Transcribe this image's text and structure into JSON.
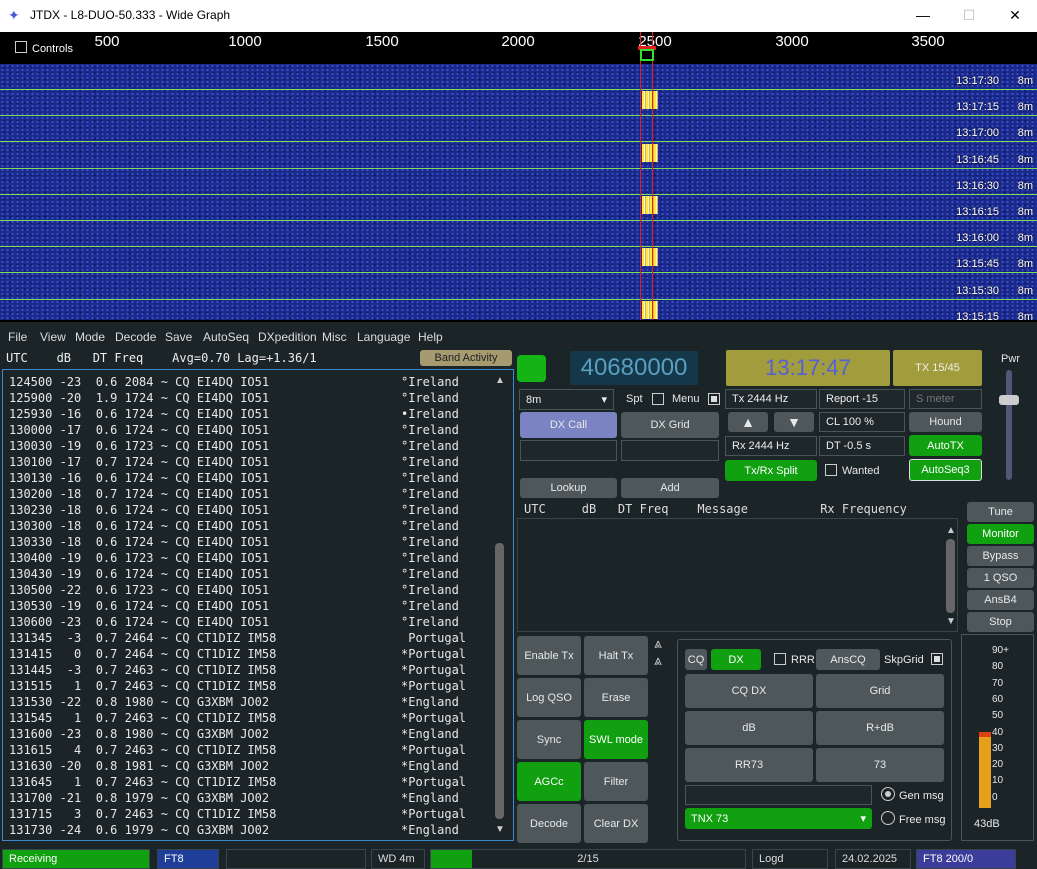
{
  "window": {
    "title": "JTDX - L8-DUO-50.333 - Wide Graph",
    "minimize": "—",
    "maximize": "☐",
    "close": "✕"
  },
  "widegraph": {
    "controls_label": "Controls",
    "scale": [
      "500",
      "1000",
      "1500",
      "2000",
      "2500",
      "3000",
      "3500"
    ],
    "timestamps": [
      [
        "13:17:30",
        "8m"
      ],
      [
        "13:17:15",
        "8m"
      ],
      [
        "13:17:00",
        "8m"
      ],
      [
        "13:16:45",
        "8m"
      ],
      [
        "13:16:30",
        "8m"
      ],
      [
        "13:16:15",
        "8m"
      ],
      [
        "13:16:00",
        "8m"
      ],
      [
        "13:15:45",
        "8m"
      ],
      [
        "13:15:30",
        "8m"
      ],
      [
        "13:15:15",
        "8m"
      ]
    ]
  },
  "menu": [
    "File",
    "View",
    "Mode",
    "Decode",
    "Save",
    "AutoSeq",
    "DXpedition",
    "Misc",
    "Language",
    "Help"
  ],
  "left": {
    "header": "UTC    dB   DT Freq    Avg=0.70 Lag=+1.36/1",
    "band_activity": "Band Activity",
    "rows": [
      [
        "124500 -23  0.6 2084 ~ CQ EI4DQ IO51",
        "°Ireland"
      ],
      [
        "125900 -20  1.9 1724 ~ CQ EI4DQ IO51",
        "°Ireland"
      ],
      [
        "125930 -16  0.6 1724 ~ CQ EI4DQ IO51",
        "•Ireland"
      ],
      [
        "130000 -17  0.6 1724 ~ CQ EI4DQ IO51",
        "°Ireland"
      ],
      [
        "130030 -19  0.6 1723 ~ CQ EI4DQ IO51",
        "°Ireland"
      ],
      [
        "130100 -17  0.7 1724 ~ CQ EI4DQ IO51",
        "°Ireland"
      ],
      [
        "130130 -16  0.6 1724 ~ CQ EI4DQ IO51",
        "°Ireland"
      ],
      [
        "130200 -18  0.7 1724 ~ CQ EI4DQ IO51",
        "°Ireland"
      ],
      [
        "130230 -18  0.6 1724 ~ CQ EI4DQ IO51",
        "°Ireland"
      ],
      [
        "130300 -18  0.6 1724 ~ CQ EI4DQ IO51",
        "°Ireland"
      ],
      [
        "130330 -18  0.6 1724 ~ CQ EI4DQ IO51",
        "°Ireland"
      ],
      [
        "130400 -19  0.6 1723 ~ CQ EI4DQ IO51",
        "°Ireland"
      ],
      [
        "130430 -19  0.6 1724 ~ CQ EI4DQ IO51",
        "°Ireland"
      ],
      [
        "130500 -22  0.6 1723 ~ CQ EI4DQ IO51",
        "°Ireland"
      ],
      [
        "130530 -19  0.6 1724 ~ CQ EI4DQ IO51",
        "°Ireland"
      ],
      [
        "130600 -23  0.6 1724 ~ CQ EI4DQ IO51",
        "°Ireland"
      ],
      [
        "131345  -3  0.7 2464 ~ CQ CT1DIZ IM58",
        " Portugal"
      ],
      [
        "131415   0  0.7 2464 ~ CQ CT1DIZ IM58",
        "*Portugal"
      ],
      [
        "131445  -3  0.7 2463 ~ CQ CT1DIZ IM58",
        "*Portugal"
      ],
      [
        "131515   1  0.7 2463 ~ CQ CT1DIZ IM58",
        "*Portugal"
      ],
      [
        "131530 -22  0.8 1980 ~ CQ G3XBM JO02",
        "*England"
      ],
      [
        "131545   1  0.7 2463 ~ CQ CT1DIZ IM58",
        "*Portugal"
      ],
      [
        "131600 -23  0.8 1980 ~ CQ G3XBM JO02",
        "*England"
      ],
      [
        "131615   4  0.7 2463 ~ CQ CT1DIZ IM58",
        "*Portugal"
      ],
      [
        "131630 -20  0.8 1981 ~ CQ G3XBM JO02",
        "*England"
      ],
      [
        "131645   1  0.7 2463 ~ CQ CT1DIZ IM58",
        "*Portugal"
      ],
      [
        "131700 -21  0.8 1979 ~ CQ G3XBM JO02",
        "*England"
      ],
      [
        "131715   3  0.7 2463 ~ CQ CT1DIZ IM58",
        "*Portugal"
      ],
      [
        "131730 -24  0.6 1979 ~ CQ G3XBM JO02",
        "*England"
      ]
    ]
  },
  "top": {
    "frequency": "40680000",
    "clock": "13:17:47",
    "tx_period": "TX 15/45",
    "band": "8m",
    "spt": "Spt",
    "menu": "Menu",
    "tx": "Tx  2444  Hz",
    "rx": "Rx  2444  Hz",
    "report": "Report -15",
    "s_meter": "S meter",
    "cl": "CL  100 %",
    "dt": "DT  -0.5 s",
    "hound": "Hound",
    "autotx": "AutoTX",
    "autoseq": "AutoSeq3",
    "txrx_split": "Tx/Rx Split",
    "wanted": "Wanted",
    "dx_call": "DX Call",
    "dx_grid": "DX Grid",
    "lookup": "Lookup",
    "add": "Add",
    "pwr": "Pwr",
    "up": "▲",
    "down": "▼"
  },
  "rx": {
    "header": "UTC     dB   DT Freq    Message          Rx Frequency"
  },
  "side": {
    "tune": "Tune",
    "monitor": "Monitor",
    "bypass": "Bypass",
    "one_qso": "1 QSO",
    "ansb4": "AnsB4",
    "stop": "Stop"
  },
  "controls": {
    "enable_tx": "Enable Tx",
    "halt_tx": "Halt Tx",
    "log_qso": "Log QSO",
    "erase": "Erase",
    "sync": "Sync",
    "swl_mode": "SWL mode",
    "agcc": "AGCc",
    "filter": "Filter",
    "decode": "Decode",
    "clear_dx": "Clear DX"
  },
  "msg": {
    "cq": "CQ",
    "dx": "DX",
    "rrr": "RRR",
    "anscq": "AnsCQ",
    "skpgrid": "SkpGrid",
    "cq_dx": "CQ DX",
    "grid": "Grid",
    "db": "dB",
    "r_db": "R+dB",
    "rr73": "RR73",
    "s73": "73",
    "gen_msg": "Gen msg",
    "free_msg": "Free msg",
    "free_text": "TNX 73"
  },
  "meter": {
    "labels": [
      "90+",
      "80",
      "70",
      "60",
      "50",
      "40",
      "30",
      "20",
      "10",
      "0"
    ],
    "value": "43dB"
  },
  "status": {
    "receiving": "Receiving",
    "mode": "FT8",
    "wd": "WD 4m",
    "progress": "2/15",
    "progress_fraction": 0.13,
    "logd": "Logd",
    "date": "24.02.2025",
    "mode_count": "FT8  200/0"
  }
}
